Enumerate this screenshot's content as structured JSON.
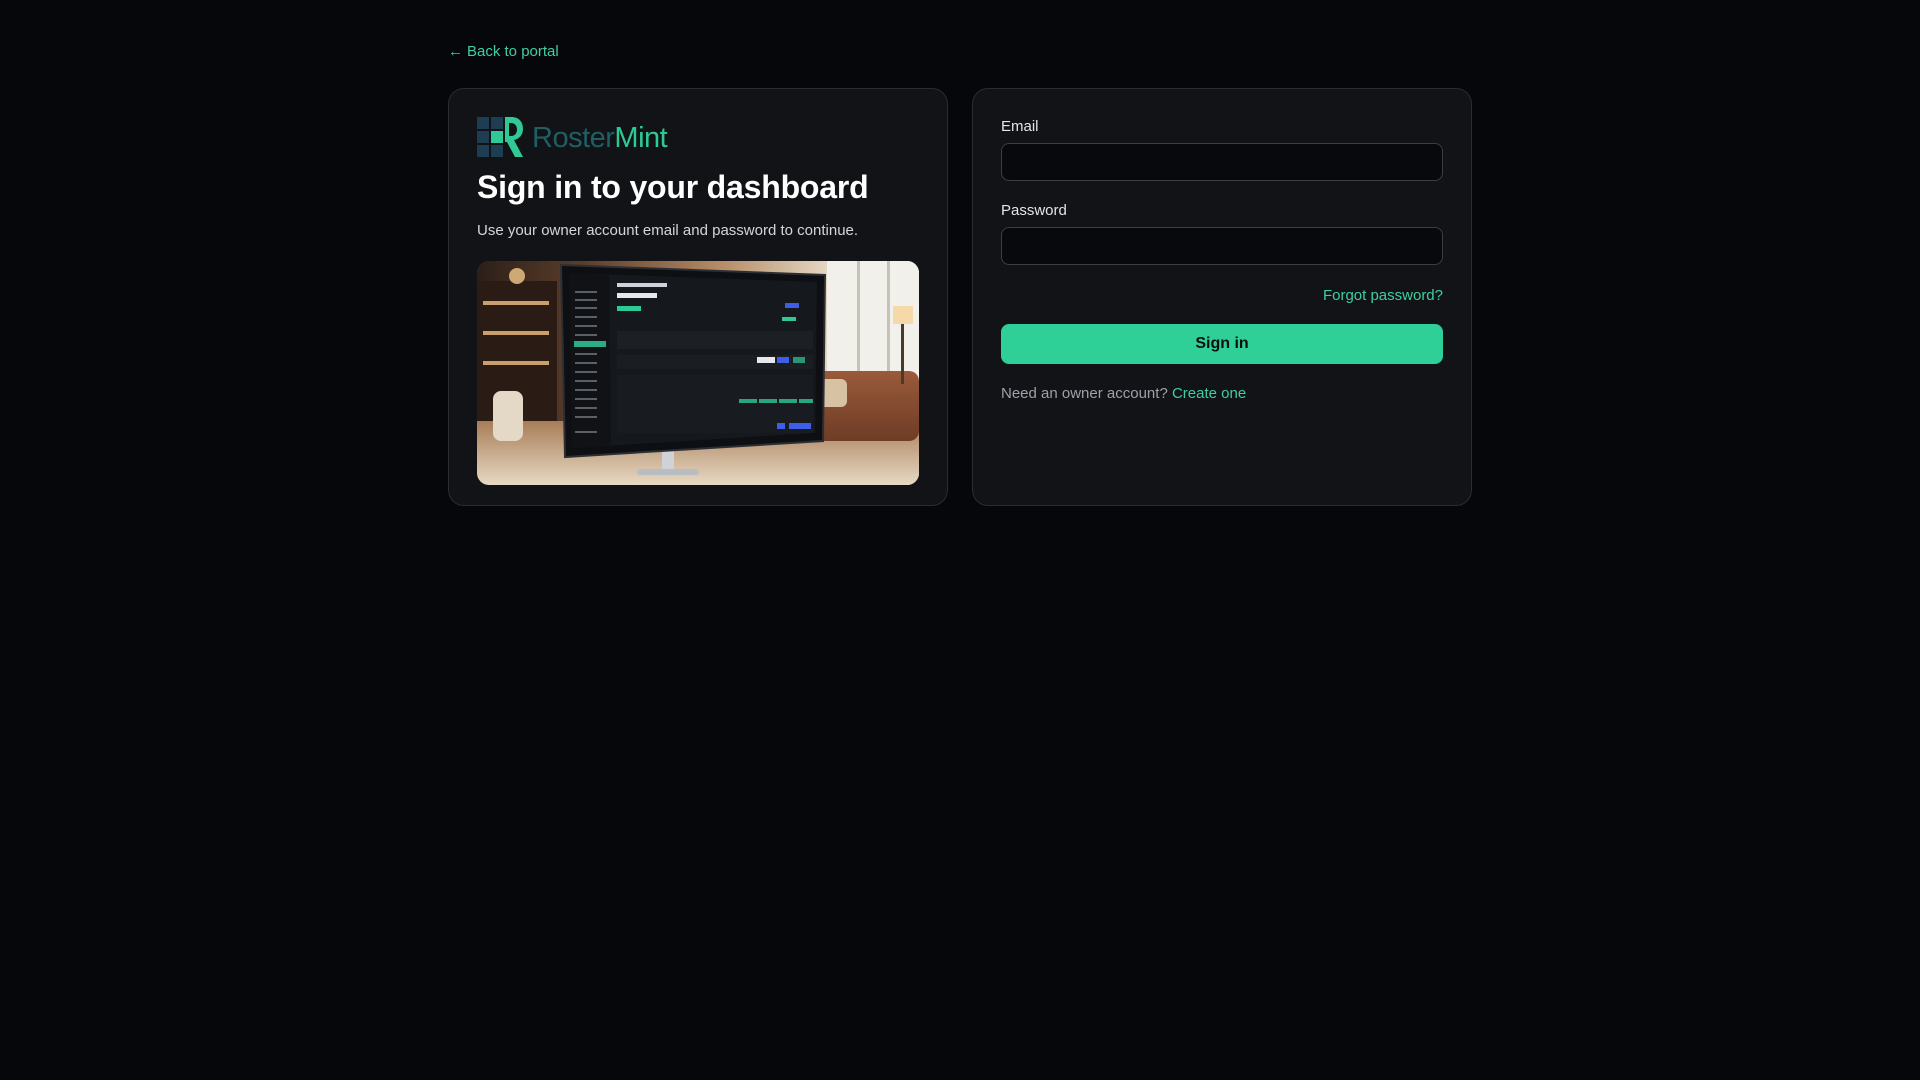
{
  "nav": {
    "back_arrow": "←",
    "back_label": "Back to portal"
  },
  "brand": {
    "name_part1": "Roster",
    "name_part2": "Mint",
    "logo_icon": "grid-r-logo-icon",
    "colors": {
      "primary": "#2fc996",
      "secondary": "#1f5f63"
    }
  },
  "intro": {
    "title": "Sign in to your dashboard",
    "subtitle": "Use your owner account email and password to continue."
  },
  "form": {
    "email_label": "Email",
    "email_value": "",
    "password_label": "Password",
    "password_value": "",
    "forgot_label": "Forgot password?",
    "submit_label": "Sign in",
    "create_prompt": "Need an owner account?",
    "create_label": "Create one"
  },
  "theme": {
    "background": "#06070b",
    "card": "#121316",
    "accent": "#2fcf98"
  }
}
